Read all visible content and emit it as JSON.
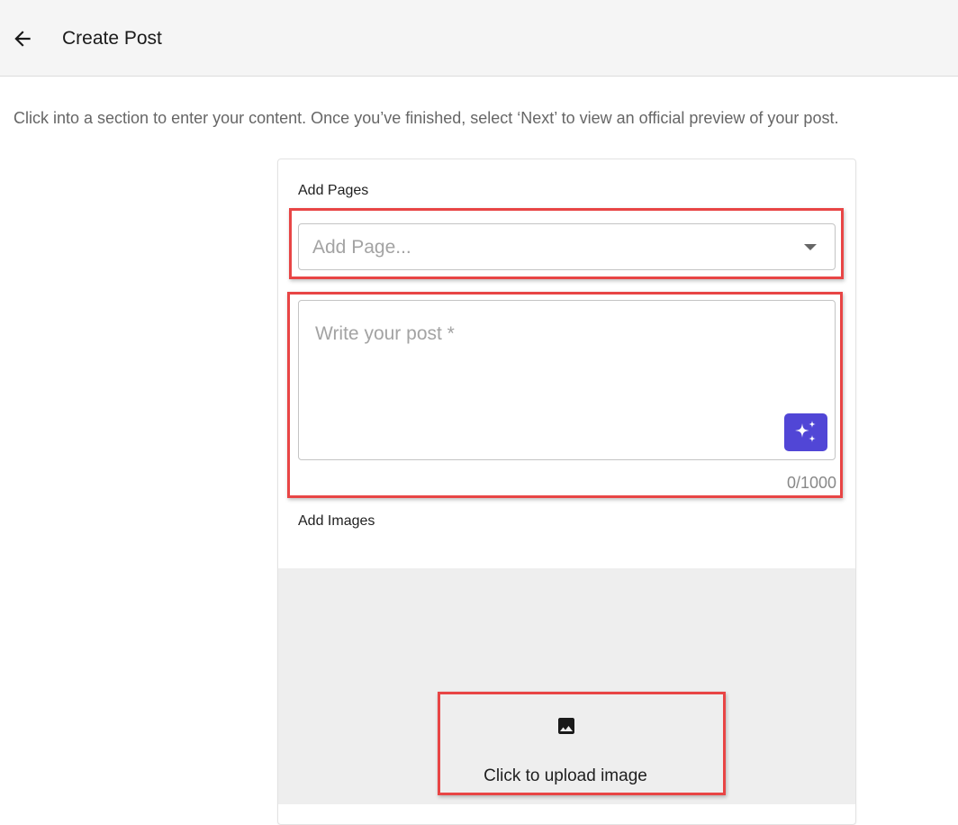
{
  "header": {
    "title": "Create Post",
    "back_icon": "arrow-left-icon"
  },
  "instructions": "Click into a section to enter your content. Once you’ve finished, select ‘Next’ to view an official preview of your post.",
  "form": {
    "pages_label": "Add Pages",
    "pages_placeholder": "Add Page...",
    "pages_dropdown_icon": "caret-down-icon",
    "post_placeholder": "Write your post *",
    "ai_button_icon": "sparkles-icon",
    "ai_button_color": "#5146d6",
    "char_count": "0/1000",
    "images_label": "Add Images",
    "upload_icon": "image-icon",
    "upload_label": "Click to upload image"
  },
  "colors": {
    "highlight": "#e84545",
    "header_bg": "#f5f5f5",
    "upload_bg": "#eeeeee"
  }
}
